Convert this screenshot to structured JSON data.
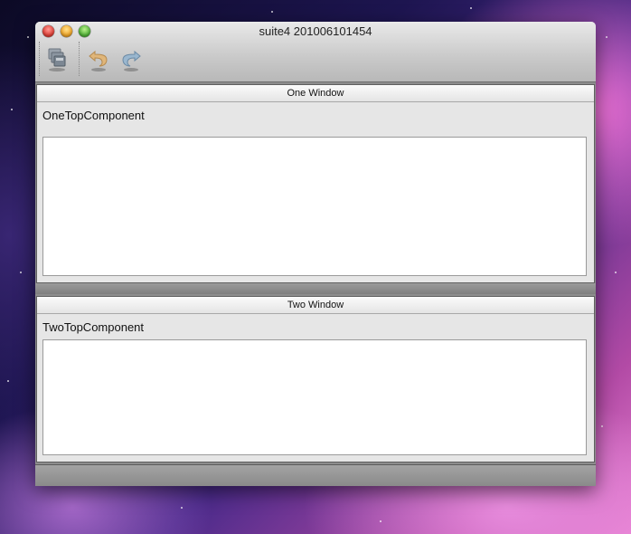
{
  "window": {
    "title": "suite4 201006101454"
  },
  "toolbar": {
    "items": [
      {
        "name": "save-all-icon"
      },
      {
        "name": "undo-icon"
      },
      {
        "name": "redo-icon"
      }
    ]
  },
  "panels": [
    {
      "header": "One Window",
      "label": "OneTopComponent"
    },
    {
      "header": "Two Window",
      "label": "TwoTopComponent"
    }
  ],
  "colors": {
    "titlebar_top": "#e9e9e9",
    "titlebar_bottom": "#b8b8b8",
    "panel_bg": "#e6e6e6",
    "content_bg": "#8d8d8d"
  }
}
